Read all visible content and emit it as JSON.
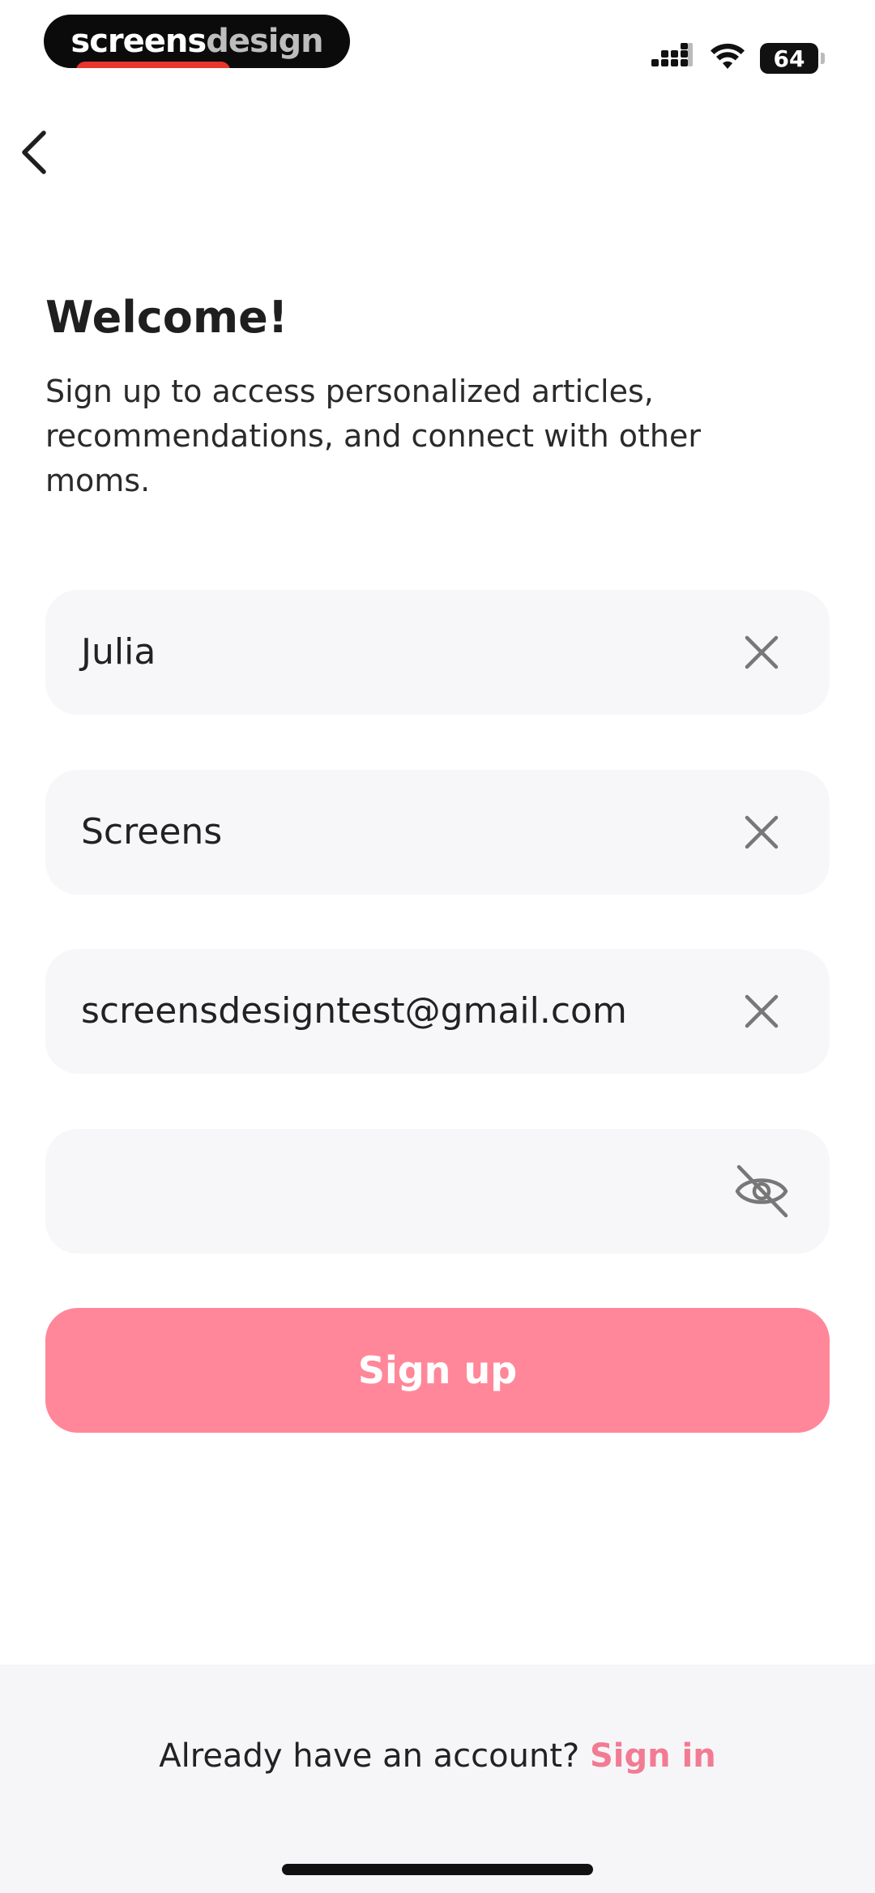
{
  "status_bar": {
    "brand_part1": "screens",
    "brand_part2": "design",
    "battery": "64",
    "icons": [
      "signal-icon",
      "wifi-icon",
      "battery-icon"
    ]
  },
  "header": {
    "back_icon": "chevron-left-icon"
  },
  "intro": {
    "title": "Welcome!",
    "subtitle": "Sign up to access personalized articles, recommendations, and connect with other moms."
  },
  "form": {
    "first_name": {
      "value": "Julia",
      "action_icon": "clear-icon"
    },
    "last_name": {
      "value": "Screens",
      "action_icon": "clear-icon"
    },
    "email": {
      "value": "screensdesigntest@gmail.com",
      "action_icon": "clear-icon"
    },
    "password": {
      "value": "",
      "action_icon": "eye-off-icon"
    },
    "submit_label": "Sign up"
  },
  "footer": {
    "prompt": "Already have an account?",
    "link_label": "Sign in"
  },
  "colors": {
    "accent": "#ff8799",
    "link": "#f27b93",
    "field_bg": "#f7f7f9",
    "footer_bg": "#f6f6f8"
  }
}
